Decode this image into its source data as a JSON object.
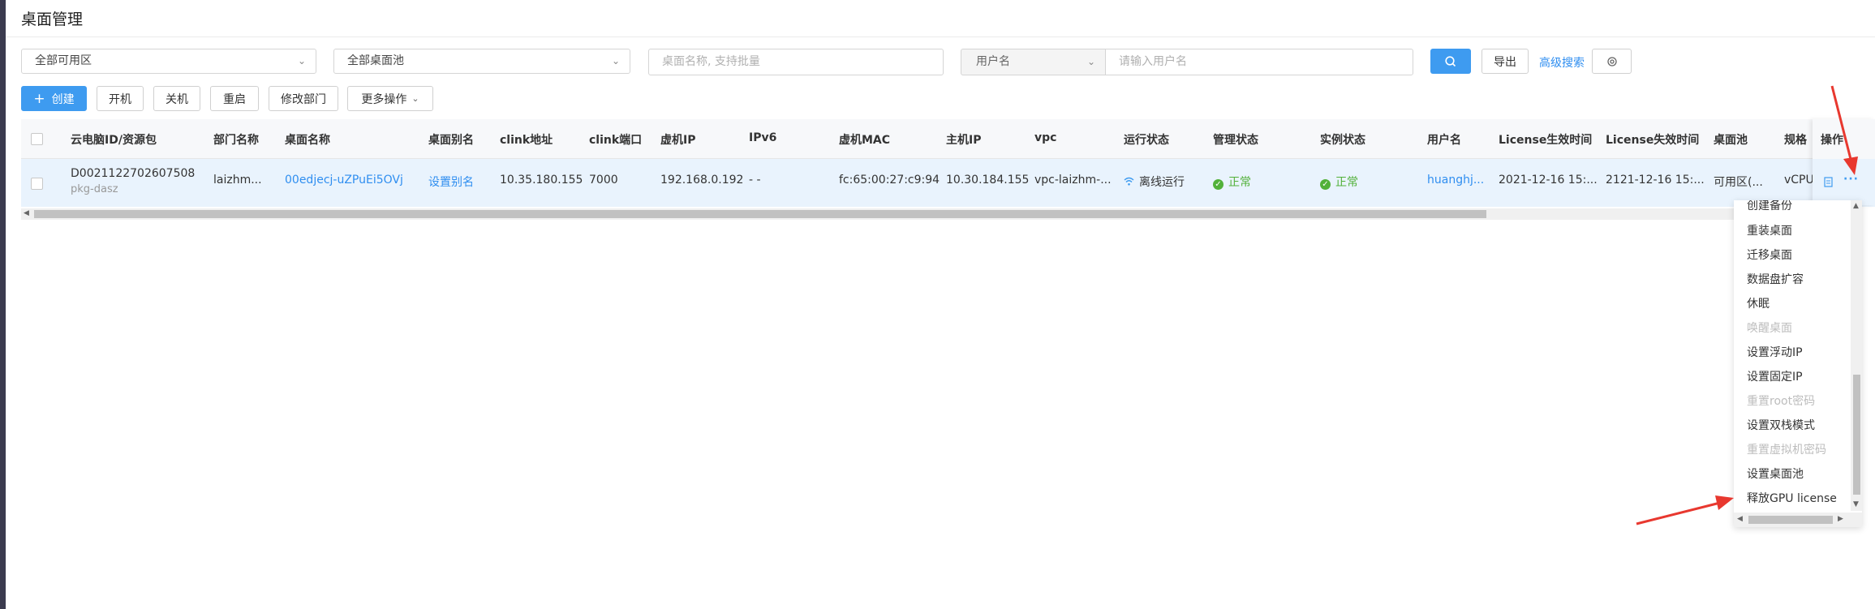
{
  "page": {
    "title": "桌面管理"
  },
  "filters": {
    "zone_select": "全部可用区",
    "pool_select": "全部桌面池",
    "name_placeholder": "桌面名称, 支持批量",
    "user_field_select": "用户名",
    "user_placeholder": "请输入用户名",
    "export_label": "导出",
    "advanced_search_label": "高级搜索"
  },
  "toolbar": {
    "create_label": "创建",
    "power_on_label": "开机",
    "power_off_label": "关机",
    "restart_label": "重启",
    "change_dept_label": "修改部门",
    "more_label": "更多操作"
  },
  "table": {
    "headers": {
      "id": "云电脑ID/资源包",
      "dept": "部门名称",
      "desktop_name": "桌面名称",
      "alias": "桌面别名",
      "clink_addr": "clink地址",
      "clink_port": "clink端口",
      "vm_ip": "虚机IP",
      "ipv6": "IPv6",
      "vm_mac": "虚机MAC",
      "host_ip": "主机IP",
      "vpc": "vpc",
      "run_status": "运行状态",
      "mgmt_status": "管理状态",
      "instance_status": "实例状态",
      "username": "用户名",
      "license_start": "License生效时间",
      "license_end": "License失效时间",
      "pool": "桌面池",
      "spec": "规格",
      "ops": "操作"
    },
    "rows": [
      {
        "id": "D0021122702607508",
        "package": "pkg-dasz",
        "dept": "laizhm...",
        "desktop_name": "00edjecj-uZPuEi5OVj",
        "alias": "设置别名",
        "clink_addr": "10.35.180.155",
        "clink_port": "7000",
        "vm_ip": "192.168.0.192",
        "ipv6": "- -",
        "vm_mac": "fc:65:00:27:c9:94",
        "host_ip": "10.30.184.155",
        "vpc": "vpc-laizhm-...",
        "run_status": "离线运行",
        "mgmt_status": "正常",
        "instance_status": "正常",
        "username": "huanghj...",
        "license_start": "2021-12-16 15:...",
        "license_end": "2121-12-16 15:...",
        "pool": "可用区(...",
        "spec": "vCPU"
      }
    ]
  },
  "more_menu": {
    "items": [
      {
        "label": "创建备份",
        "disabled": false
      },
      {
        "label": "重装桌面",
        "disabled": false
      },
      {
        "label": "迁移桌面",
        "disabled": false
      },
      {
        "label": "数据盘扩容",
        "disabled": false
      },
      {
        "label": "休眠",
        "disabled": false
      },
      {
        "label": "唤醒桌面",
        "disabled": true
      },
      {
        "label": "设置浮动IP",
        "disabled": false
      },
      {
        "label": "设置固定IP",
        "disabled": false
      },
      {
        "label": "重置root密码",
        "disabled": true
      },
      {
        "label": "设置双栈模式",
        "disabled": false
      },
      {
        "label": "重置虚拟机密码",
        "disabled": true
      },
      {
        "label": "设置桌面池",
        "disabled": false
      },
      {
        "label": "释放GPU license",
        "disabled": false
      }
    ]
  },
  "colors": {
    "accent": "#3e9bf0",
    "link": "#2f8ef0",
    "success": "#52b13a",
    "annotation": "#e8382f"
  }
}
